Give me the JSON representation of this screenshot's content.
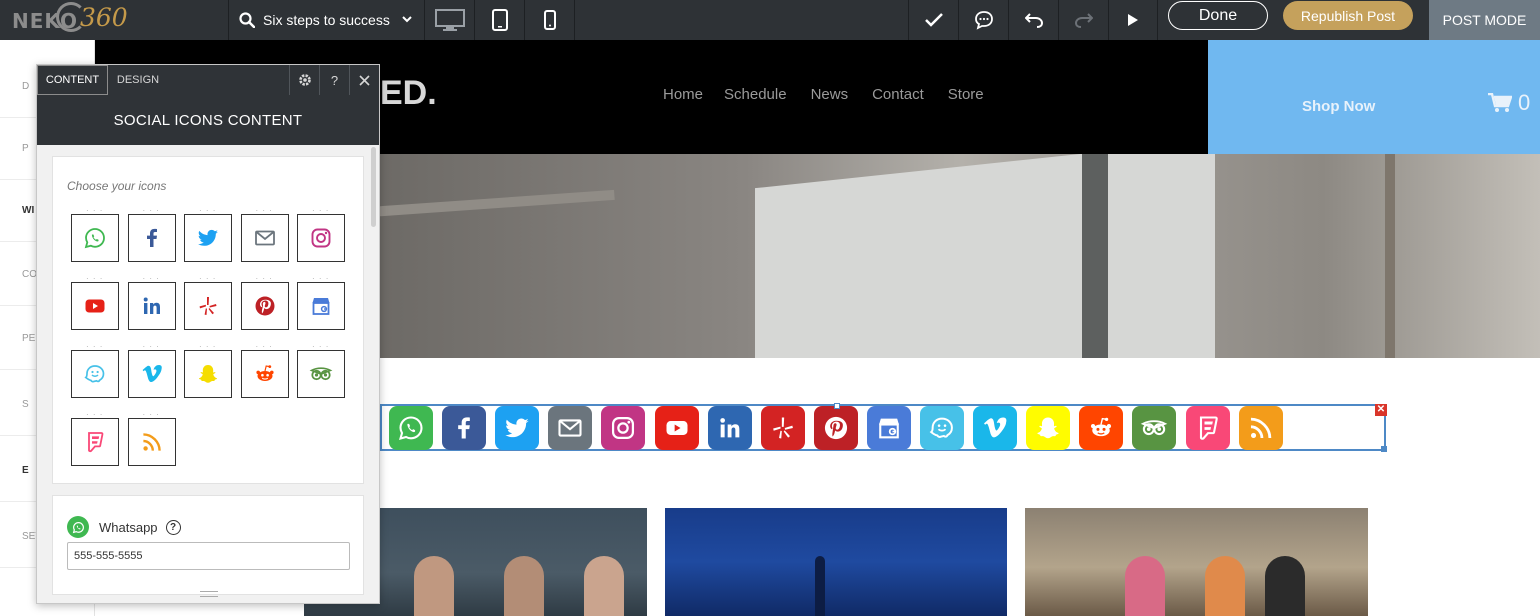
{
  "toolbar": {
    "logo_text": "NEKO",
    "logo_number": "360",
    "page_name": "Six steps to success",
    "done_label": "Done",
    "republish_label": "Republish Post",
    "post_mode_label": "POST MODE"
  },
  "rail": {
    "items": [
      "D",
      "P",
      "WI",
      "CO",
      "PERS",
      "S",
      "E",
      "SET"
    ]
  },
  "site": {
    "logo_fragment": "ED.",
    "nav": [
      "Home",
      "Schedule",
      "News",
      "Contact",
      "Store"
    ],
    "shop_label": "Shop Now",
    "cart_count": "0"
  },
  "panel": {
    "tab_content": "CONTENT",
    "tab_design": "DESIGN",
    "help_label": "?",
    "title": "SOCIAL ICONS CONTENT",
    "chooser_label": "Choose your icons",
    "item": {
      "name": "Whatsapp",
      "help_label": "?",
      "value": "555-555-5555"
    }
  },
  "icons": [
    {
      "name": "whatsapp",
      "color": "#3fb851"
    },
    {
      "name": "facebook",
      "color": "#3b5998"
    },
    {
      "name": "twitter",
      "color": "#1da1f2"
    },
    {
      "name": "email",
      "color": "#6b757d"
    },
    {
      "name": "instagram",
      "color": "#c13584"
    },
    {
      "name": "youtube",
      "color": "#e62117"
    },
    {
      "name": "linkedin",
      "color": "#2e67b1"
    },
    {
      "name": "yelp",
      "color": "#d32323"
    },
    {
      "name": "pinterest",
      "color": "#bd2126"
    },
    {
      "name": "google-business",
      "color": "#4a7bd8"
    },
    {
      "name": "waze",
      "color": "#47c1e8"
    },
    {
      "name": "vimeo",
      "color": "#1ab7ea"
    },
    {
      "name": "snapchat",
      "color": "#fffc00"
    },
    {
      "name": "reddit",
      "color": "#ff4500"
    },
    {
      "name": "tripadvisor",
      "color": "#589442"
    },
    {
      "name": "foursquare",
      "color": "#f94877"
    },
    {
      "name": "rss",
      "color": "#f39c1a"
    }
  ]
}
